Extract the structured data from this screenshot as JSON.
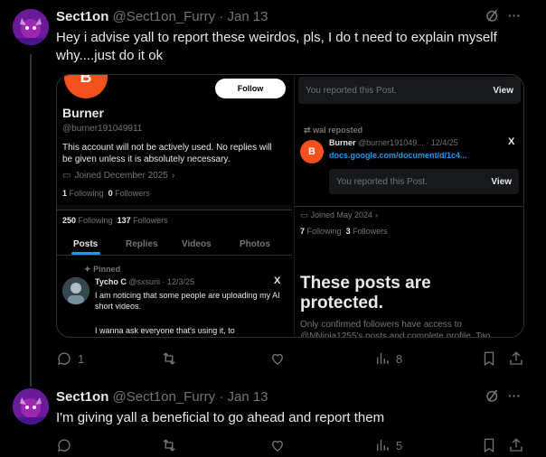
{
  "post1": {
    "name": "Sect1on",
    "handle": "@Sect1on_Furry",
    "dot": "·",
    "date": "Jan 13",
    "text": "Hey i advise yall to report these weirdos, pls, I do t need to explain myself why....just do it ok",
    "actions": {
      "replies": "1",
      "views": "8"
    }
  },
  "post2": {
    "name": "Sect1on",
    "handle": "@Sect1on_Furry",
    "dot": "·",
    "date": "Jan 13",
    "text": "I'm giving yall a beneficial to go ahead and report them",
    "actions": {
      "views": "5"
    }
  },
  "more_glyph": "···",
  "left_shot": {
    "avatar_letter": "B",
    "follow_label": "Follow",
    "name": "Burner",
    "handle": "@burner191049911",
    "bio": "This account will not be actively used. No replies will be given unless it is absolutely necessary.",
    "joined": "Joined December 2025",
    "following_count": "1",
    "following_label": "Following",
    "followers_count": "0",
    "followers_label": "Followers",
    "stats2_following_count": "250",
    "stats2_followers_count": "137",
    "tabs": [
      "Posts",
      "Replies",
      "Videos",
      "Photos"
    ],
    "pinned_label": "Pinned",
    "pinned_name": "Tycho C",
    "pinned_handle": "@sxsurii",
    "pinned_date": "12/3/25",
    "pinned_text1": "I am noticing that some people are uploading my AI short videos.",
    "pinned_text2": "I wanna ask everyone that's using it, to",
    "x_glyph": "X"
  },
  "right_shot": {
    "reported_text": "You reported this Post.",
    "view_label": "View",
    "repost_label": "wal reposted",
    "avatar_letter": "B",
    "name": "Burner",
    "handle": "@burner191049...",
    "date": "12/4/25",
    "link": "docs.google.com/document/d/1c4...",
    "x_glyph": "X",
    "joined": "Joined May 2024",
    "following_count": "7",
    "following_label": "Following",
    "followers_count": "3",
    "followers_label": "Followers",
    "protected_title": "These posts are protected.",
    "protected_text": "Only confirmed followers have access to @NNinja1255's posts and complete profile. Tap"
  },
  "colors": {
    "accent": "#1d9bf0",
    "muted": "#71767b",
    "avatar_bg": "#f4511e"
  }
}
